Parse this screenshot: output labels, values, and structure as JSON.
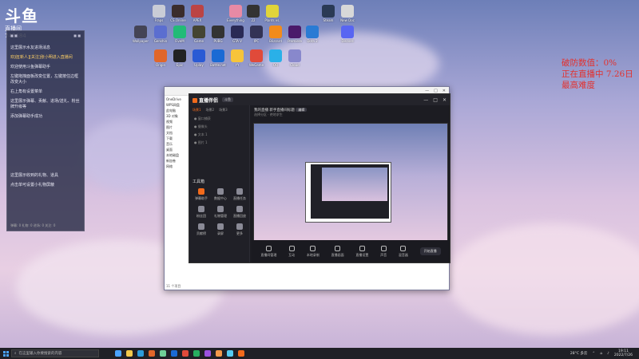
{
  "overlay_logo": {
    "mark": "斗鱼",
    "sub": "直播间",
    "room": "742684"
  },
  "overlay_status": {
    "line1": "破防数值：0%",
    "line2": "正在直播中 7.26日",
    "line3": "最高难度"
  },
  "chat": {
    "header_left": "■ ■",
    "header_right": "■ ■",
    "messages": [
      "这里展示水友进场消息",
      "欢迎[新人][关注]张小明进入直播间",
      "欢迎使用斗鱼弹幕助手",
      "左键拖拽面板改变位置，左键按住边框改变大小",
      "右上角有设置菜单",
      "这里展示弹幕、贡献、进场/送礼、粉丝牌升级等",
      "添加弹幕助手成功",
      "这里展示收到的礼物、道具",
      "点击单可设置小礼物屏蔽"
    ],
    "footer": "弹幕: 0   礼物: 0   进场: 0   关注: 0"
  },
  "desktop_icons": [
    {
      "label": "Fraps",
      "color": "#c9ccd6"
    },
    {
      "label": "CS.Online",
      "color": "#3a2c2c"
    },
    {
      "label": "APEX",
      "color": "#b44"
    },
    {
      "label": "Everything",
      "color": "#e88aa5"
    },
    {
      "label": "22",
      "color": "#333"
    },
    {
      "label": "Plants vs.",
      "color": "#e0d43a"
    },
    {
      "label": "Steam",
      "color": "#2a3a55"
    },
    {
      "label": "New Doc",
      "color": "#d8d8d8"
    },
    {
      "label": "Wallpaper",
      "color": "#445"
    },
    {
      "label": "Genshin",
      "color": "#5b6ed0"
    },
    {
      "label": "FiveM",
      "color": "#2b7"
    },
    {
      "label": "Game",
      "color": "#443"
    },
    {
      "label": "PUBG",
      "color": "#333"
    },
    {
      "label": "GTA V",
      "color": "#2a2a55"
    },
    {
      "label": "IPC",
      "color": "#335"
    },
    {
      "label": "Blizzard",
      "color": "#f28b1b"
    },
    {
      "label": "Premiere",
      "color": "#4a1a6a"
    },
    {
      "label": "Dota 2",
      "color": "#2a7bd4"
    },
    {
      "label": "Discord",
      "color": "#5865f2"
    },
    {
      "label": "Origin",
      "color": "#e0662a"
    },
    {
      "label": "Epic",
      "color": "#222"
    },
    {
      "label": "Uplay",
      "color": "#2a5ad4"
    },
    {
      "label": "Battle.net",
      "color": "#1a6ad4"
    },
    {
      "label": "YY",
      "color": "#f6c43a"
    },
    {
      "label": "WeGame",
      "color": "#e04a3a"
    },
    {
      "label": "QQ",
      "color": "#2ab0e8"
    },
    {
      "label": "Cloud",
      "color": "#88c"
    }
  ],
  "explorer": {
    "window_controls": [
      "—",
      "□",
      "✕"
    ],
    "nav_items": [
      "OneDrive",
      "WPS网盘",
      "此电脑",
      "3D 对象",
      "视频",
      "图片",
      "文档",
      "下载",
      "音乐",
      "桌面",
      "本地磁盘",
      "新加卷",
      "网络"
    ],
    "status": "11 个项目"
  },
  "companion": {
    "brand": "直播伴侣",
    "brand_badge": "斗鱼",
    "title": "我的直播 新手直播间标题",
    "title_badge": "编辑",
    "subtitle": "选择分区 · 绝地求生",
    "scene_tabs": [
      "场景1",
      "场景2",
      "场景3"
    ],
    "scene_items": [
      "● 窗口捕获",
      "● 摄像头",
      "● 文本 1",
      "● 图片 1"
    ],
    "tools_header": "工具箱",
    "tools": [
      {
        "label": "弹幕助手",
        "accent": true
      },
      {
        "label": "数据中心",
        "accent": false
      },
      {
        "label": "直播任务",
        "accent": false
      },
      {
        "label": "粉丝团",
        "accent": false
      },
      {
        "label": "礼物管理",
        "accent": false
      },
      {
        "label": "直播回放",
        "accent": false
      },
      {
        "label": "贡献榜",
        "accent": false
      },
      {
        "label": "录屏",
        "accent": false
      },
      {
        "label": "更多",
        "accent": false
      }
    ],
    "bottom_actions": [
      "直播间管理",
      "互动",
      "本地录制",
      "直播画面",
      "直播设置",
      "声音",
      "混音器"
    ],
    "start_live": "开始直播",
    "window_controls": [
      "—",
      "□",
      "✕"
    ]
  },
  "taskbar": {
    "search_placeholder": "在这里输入你要搜索的内容",
    "apps": [
      "#4aa3ff",
      "#f2c94c",
      "#2d9cdb",
      "#e0662a",
      "#6fcf97",
      "#1a6ad4",
      "#e04a3a",
      "#27ae60",
      "#9b51e0",
      "#f2994a",
      "#56ccf2",
      "#f26a1b"
    ],
    "weather": "28°C 多云",
    "time": "19:11",
    "date": "2022/7/26"
  }
}
